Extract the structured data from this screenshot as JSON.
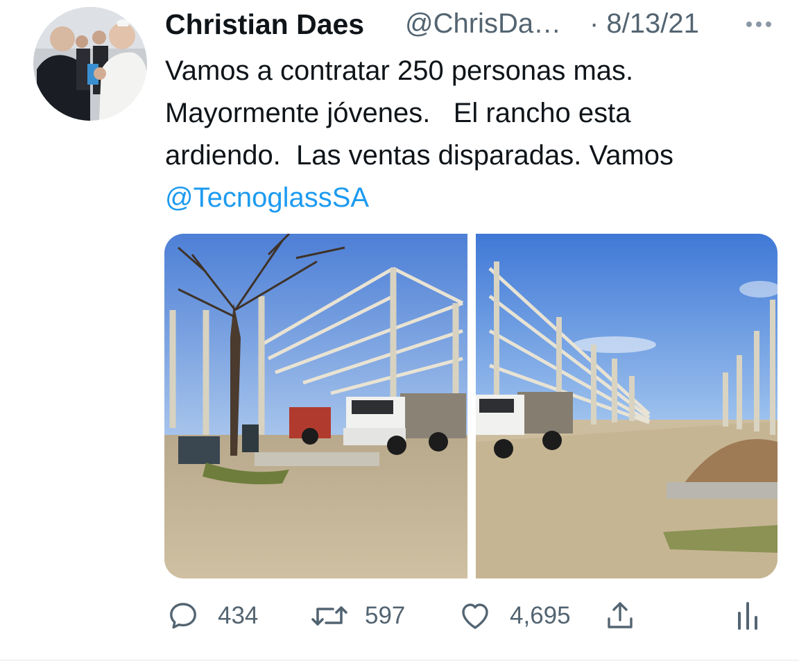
{
  "tweet": {
    "author_name": "Christian Daes",
    "author_handle": "@ChrisDa…",
    "date": "· 8/13/21",
    "text_lines": [
      "Vamos a contratar 250 personas mas.",
      "Mayormente jóvenes.   El rancho esta",
      "ardiendo.  Las ventas disparadas. Vamos"
    ],
    "mention": "@TecnoglassSA"
  },
  "icons": {
    "more": "more-dots-icon",
    "reply": "reply-bubble-icon",
    "retweet": "retweet-arrows-icon",
    "like": "heart-icon",
    "share": "share-upload-icon",
    "analytics": "analytics-bars-icon"
  },
  "actions": {
    "reply_count": "434",
    "retweet_count": "597",
    "like_count": "4,695"
  },
  "colors": {
    "text": "#0f1419",
    "secondary": "#536471",
    "link": "#1d9bf0"
  }
}
